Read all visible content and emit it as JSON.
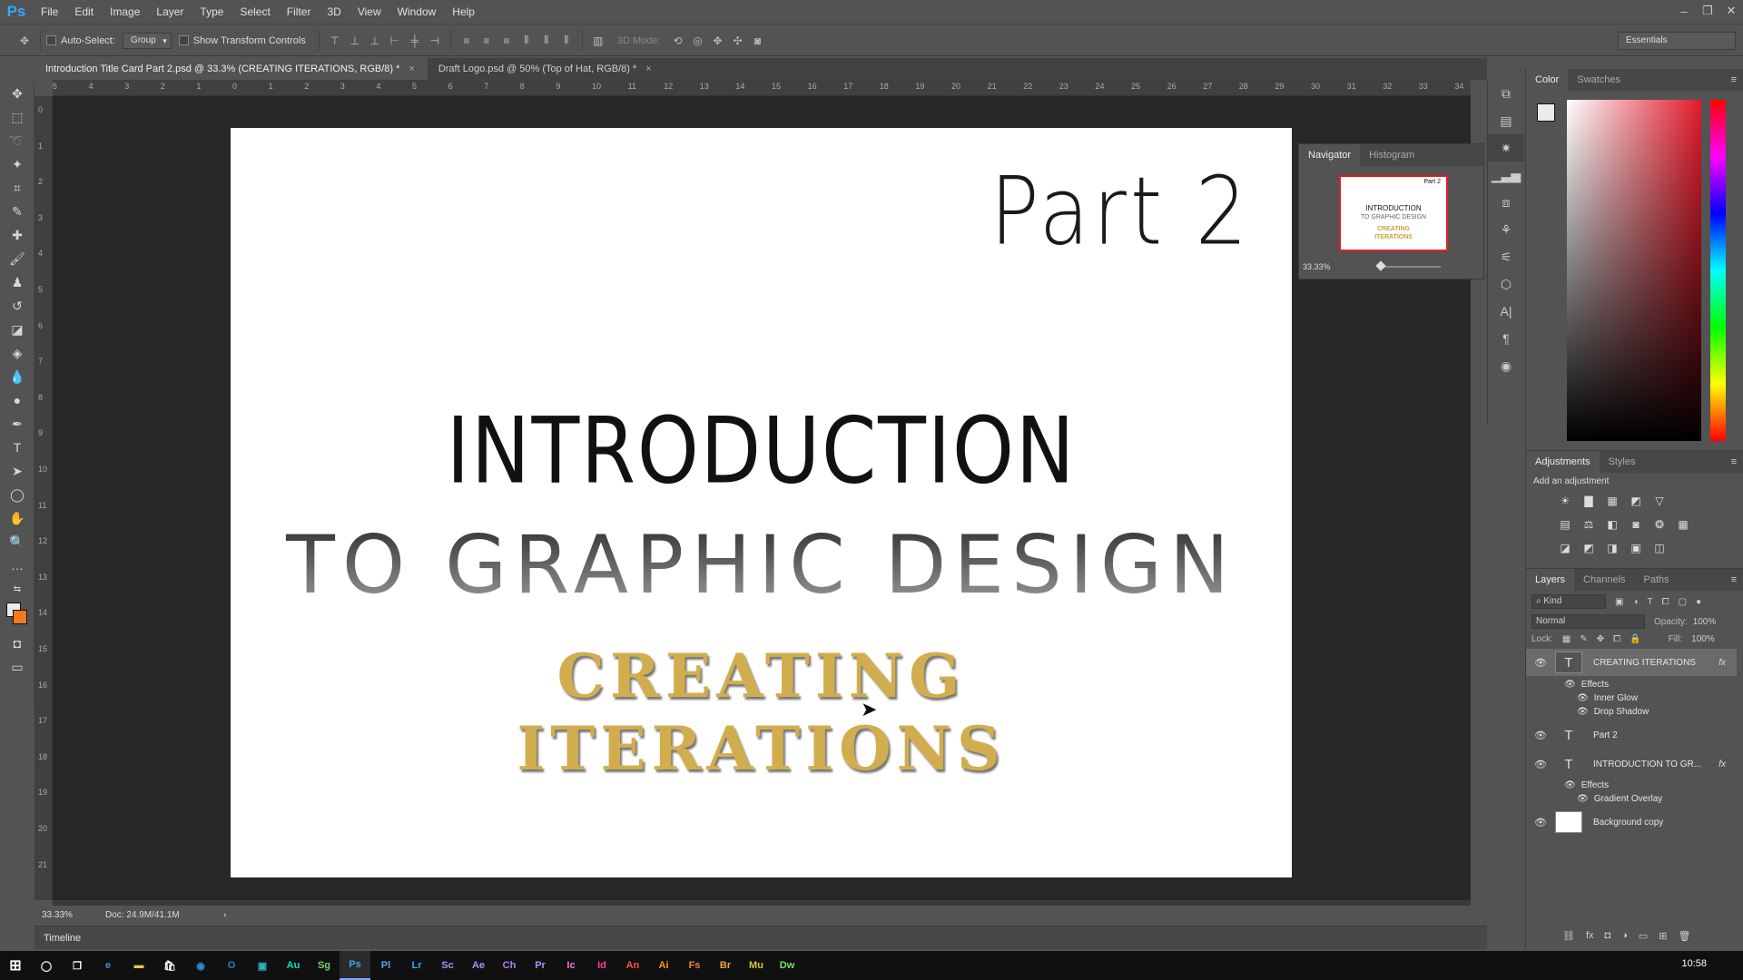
{
  "app": {
    "logo": "Ps",
    "menu": [
      "File",
      "Edit",
      "Image",
      "Layer",
      "Type",
      "Select",
      "Filter",
      "3D",
      "View",
      "Window",
      "Help"
    ],
    "window_controls": [
      "–",
      "❐",
      "✕"
    ]
  },
  "options_bar": {
    "auto_select_label": "Auto-Select:",
    "auto_select_value": "Group",
    "transform_label": "Show Transform Controls",
    "mode_3d_label": "3D Mode:",
    "workspace": "Essentials"
  },
  "tabs": [
    {
      "label": "Introduction Title Card Part 2.psd @ 33.3% (CREATING ITERATIONS, RGB/8) *",
      "close": "×",
      "active": true
    },
    {
      "label": "Draft Logo.psd @ 50% (Top of Hat, RGB/8) *",
      "close": "×",
      "active": false
    }
  ],
  "ruler": {
    "h_ticks": [
      "5",
      "4",
      "3",
      "2",
      "1",
      "0",
      "1",
      "2",
      "3",
      "4",
      "5",
      "6",
      "7",
      "8",
      "9",
      "10",
      "11",
      "12",
      "13",
      "14",
      "15",
      "16",
      "17",
      "18",
      "19",
      "20",
      "21",
      "22",
      "23",
      "24",
      "25",
      "26",
      "27",
      "28",
      "29",
      "30",
      "31",
      "32",
      "33",
      "34"
    ],
    "v_ticks": [
      "0",
      "1",
      "2",
      "3",
      "4",
      "5",
      "6",
      "7",
      "8",
      "9",
      "10",
      "11",
      "12",
      "13",
      "14",
      "15",
      "16",
      "17",
      "18",
      "19",
      "20",
      "21"
    ]
  },
  "document": {
    "part_text": "Part 2",
    "intro_line1": "INTRODUCTION",
    "intro_line2": "TO GRAPHIC DESIGN",
    "creating_line1": "CREATING",
    "creating_line2": "ITERATIONS"
  },
  "status": {
    "zoom": "33.33%",
    "doc_size": "Doc: 24.9M/41.1M",
    "arrow": "›",
    "timeline_label": "Timeline"
  },
  "navigator": {
    "tabs": [
      "Navigator",
      "Histogram"
    ],
    "zoom": "33.33%",
    "thumb_part": "Part 2",
    "thumb_intro": "INTRODUCTION",
    "thumb_graphic": "TO GRAPHIC DESIGN",
    "thumb_creating": "CREATING",
    "thumb_iterations": "ITERATIONS"
  },
  "color_panel": {
    "tabs": [
      "Color",
      "Swatches"
    ],
    "foreground": "#ebebeb",
    "background": "#f07b1d"
  },
  "adjustments": {
    "tabs": [
      "Adjustments",
      "Styles"
    ],
    "prompt": "Add an adjustment"
  },
  "layers": {
    "tabs": [
      "Layers",
      "Channels",
      "Paths"
    ],
    "filter": "Kind",
    "blend_mode": "Normal",
    "opacity_label": "Opacity:",
    "opacity": "100%",
    "lock_label": "Lock:",
    "fill_label": "Fill:",
    "fill": "100%",
    "items": [
      {
        "name": "CREATING ITERATIONS",
        "fx": "fx",
        "effects_label": "Effects",
        "effects": [
          "Inner Glow",
          "Drop Shadow"
        ]
      },
      {
        "name": "Part 2"
      },
      {
        "name": "INTRODUCTION  TO GR...",
        "fx": "fx",
        "effects_label": "Effects",
        "effects": [
          "Gradient Overlay"
        ]
      },
      {
        "name": "Background copy"
      }
    ]
  },
  "taskbar": {
    "apps": [
      "Au",
      "Sg",
      "Ps",
      "Pl",
      "Lr",
      "Sc",
      "Ae",
      "Ch",
      "Pr",
      "Ic",
      "Id",
      "An",
      "Ai",
      "Fs",
      "Br",
      "Mu",
      "Dw"
    ],
    "clock": "10:58"
  }
}
